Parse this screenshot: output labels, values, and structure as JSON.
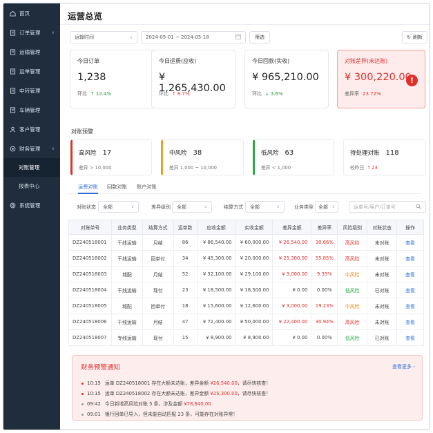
{
  "sidebar": {
    "items": [
      {
        "label": "首页",
        "icon": "home-icon"
      },
      {
        "label": "订单管理",
        "icon": "document-icon",
        "chevron": "∨"
      },
      {
        "label": "运输管理",
        "icon": "document-icon"
      },
      {
        "label": "运单管理",
        "icon": "document-icon"
      },
      {
        "label": "中转管理",
        "icon": "document-icon"
      },
      {
        "label": "车辆管理",
        "icon": "document-icon"
      },
      {
        "label": "客户管理",
        "icon": "user-icon"
      },
      {
        "label": "财务管理",
        "icon": "gear-icon",
        "chevron": "∧"
      },
      {
        "label": "对账管理",
        "sub": true,
        "active": true
      },
      {
        "label": "报表中心",
        "sub": true
      },
      {
        "label": "系统管理",
        "icon": "settings-icon"
      }
    ]
  },
  "page": {
    "title": "运营总览"
  },
  "toolbar": {
    "range_type": "运输时间",
    "date_range": "2024-05-01 ~ 2024-05-18",
    "filter_label": "筛选",
    "refresh_label": "刷新"
  },
  "stats": [
    {
      "label": "今日订单",
      "value": "1,238",
      "trend_label": "环比",
      "trend_arrow": "↑",
      "trend_value": "12.4%",
      "trend_dir": "down"
    },
    {
      "label": "今日运费(应收)",
      "value": "¥ 1,265,430.00",
      "trend_label": "环比",
      "trend_arrow": "↑",
      "trend_value": "8.7%",
      "trend_dir": "up"
    },
    {
      "label": "今日回款(实收)",
      "value": "¥ 965,210.00",
      "trend_label": "环比",
      "trend_arrow": "↓",
      "trend_value": "3.6%",
      "trend_dir": "down"
    },
    {
      "label": "对账差异(未达账)",
      "value": "¥ 300,220.00",
      "trend_label": "差异率",
      "trend_arrow": "",
      "trend_value": "23.72%",
      "trend_dir": "up",
      "alert": true
    }
  ],
  "warning": {
    "title": "对账预警",
    "cards": [
      {
        "label": "高风险",
        "count": "17",
        "desc": "差异 > 10,000",
        "level": "hi"
      },
      {
        "label": "中风险",
        "count": "38",
        "desc": "差异 1,000 ~ 10,000",
        "level": "mid"
      },
      {
        "label": "低风险",
        "count": "63",
        "desc": "差异 < 1,000",
        "level": "lo"
      },
      {
        "label": "待处理对账",
        "count": "118",
        "desc": "较昨日",
        "delta_arrow": "↑",
        "delta": "23",
        "level": "none"
      }
    ]
  },
  "tabs": [
    "运费对账",
    "回款对账",
    "账户对账"
  ],
  "filters": {
    "status_label": "对账状态",
    "status_value": "全部",
    "level_label": "差异级别",
    "level_value": "全部",
    "settle_label": "结算方式",
    "settle_value": "全部",
    "biz_label": "业务类型",
    "biz_value": "全部",
    "search_placeholder": "运单号/客户/订单号"
  },
  "table": {
    "headers": [
      "对账单号",
      "业务类型",
      "结算方式",
      "运单数",
      "应收金额",
      "实收金额",
      "差异金额",
      "差异率",
      "风险级别",
      "对账状态",
      "操作"
    ],
    "rows": [
      [
        "DZ240518001",
        "干线运输",
        "月结",
        "86",
        "¥ 86,540.00",
        "¥ 60,000.00",
        "¥ 26,540.00",
        "30.66%",
        "高风险",
        "未对账",
        "查看"
      ],
      [
        "DZ240518002",
        "干线运输",
        "回单付",
        "34",
        "¥ 45,300.00",
        "¥ 20,000.00",
        "¥ 25,300.00",
        "55.85%",
        "高风险",
        "未对账",
        "查看"
      ],
      [
        "DZ240518003",
        "城配",
        "月结",
        "52",
        "¥ 32,100.00",
        "¥ 29,100.00",
        "¥ 3,000.00",
        "9.35%",
        "中风险",
        "未对账",
        "查看"
      ],
      [
        "DZ240518004",
        "干线运输",
        "现付",
        "23",
        "¥ 18,500.00",
        "¥ 18,500.00",
        "¥ 0.00",
        "0.00%",
        "低风险",
        "已对账",
        "查看"
      ],
      [
        "DZ240518005",
        "城配",
        "回单付",
        "18",
        "¥ 15,600.00",
        "¥ 12,600.00",
        "¥ 3,000.00",
        "19.23%",
        "中风险",
        "未对账",
        "查看"
      ],
      [
        "DZ240518006",
        "干线运输",
        "月结",
        "47",
        "¥ 72,400.00",
        "¥ 50,000.00",
        "¥ 22,400.00",
        "30.94%",
        "高风险",
        "未对账",
        "查看"
      ],
      [
        "DZ240518007",
        "专线运输",
        "现付",
        "15",
        "¥ 8,900.00",
        "¥ 8,900.00",
        "¥ 0.00",
        "0.00%",
        "低风险",
        "已对账",
        "查看"
      ]
    ],
    "row_levels": [
      "hi",
      "hi",
      "mid",
      "lo",
      "mid",
      "hi",
      "lo"
    ]
  },
  "notice": {
    "title": "财务预警通知",
    "more": "查看更多 ›",
    "items": [
      {
        "time": "10:15",
        "pre": "运单 DZ240518001 存在大额未达账，差异金额 ",
        "amount": "¥26,540.00",
        "post": "，请尽快核查！",
        "dot": true
      },
      {
        "time": "10:15",
        "pre": "运单 DZ240518002 存在大额未达账，差异金额 ",
        "amount": "¥25,300.00",
        "post": "，请尽快核查！",
        "dot": true
      },
      {
        "time": "09:42",
        "pre": "今日新增高风险对账 5 条，涉及金额 ",
        "amount": "¥78,640.00",
        "post": "",
        "dot": false
      },
      {
        "time": "09:01",
        "pre": "银行回单已导入，但未能自动匹配 23 条，可能存在对账异常！",
        "amount": "",
        "post": "",
        "dot": false
      }
    ]
  },
  "colors": {
    "sidebar": "#1f2d3d",
    "accent": "#2e6fd9",
    "danger": "#e0302c",
    "warning": "#f0a020",
    "success": "#28a745"
  }
}
